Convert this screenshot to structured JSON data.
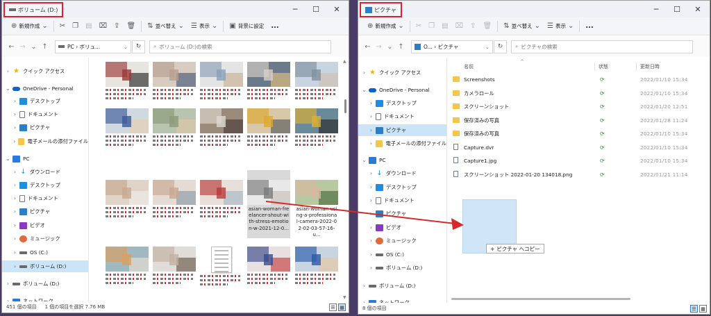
{
  "left": {
    "title": "ボリューム (D:)",
    "toolbar": {
      "new": "新規作成",
      "sort": "並べ替え",
      "view": "表示",
      "background": "背景に設定",
      "more": "..."
    },
    "address": "PC › ボリュ...",
    "search_placeholder": "ボリューム (D:)の検索",
    "nav": [
      {
        "label": "クイック アクセス",
        "icon": "star-icon"
      },
      {
        "label": "OneDrive - Personal",
        "icon": "cloud-icon"
      },
      {
        "label": "デスクトップ",
        "icon": "desktop-icon"
      },
      {
        "label": "ドキュメント",
        "icon": "document-icon"
      },
      {
        "label": "ピクチャ",
        "icon": "pictures-icon"
      },
      {
        "label": "電子メールの添付ファイル",
        "icon": "folder-icon"
      },
      {
        "label": "PC",
        "icon": "pc-icon"
      },
      {
        "label": "ダウンロード",
        "icon": "download-icon"
      },
      {
        "label": "デスクトップ",
        "icon": "desktop-icon"
      },
      {
        "label": "ドキュメント",
        "icon": "document-icon"
      },
      {
        "label": "ピクチャ",
        "icon": "pictures-icon"
      },
      {
        "label": "ビデオ",
        "icon": "video-icon"
      },
      {
        "label": "ミュージック",
        "icon": "music-icon"
      },
      {
        "label": "OS (C:)",
        "icon": "drive-icon"
      },
      {
        "label": "ボリューム (D:)",
        "icon": "drive-icon"
      },
      {
        "label": "ボリューム (D:)",
        "icon": "drive-icon"
      },
      {
        "label": "ネットワーク",
        "icon": "network-icon"
      }
    ],
    "captions": {
      "selected": "asian-woman-freelancer-shout-with-stress-emotion-w-2021-12-0...",
      "neighbor": "asian-woman-using-a-professional-camera-2022-02-02-03-57-16-u..."
    },
    "status": {
      "count": "451 個の項目",
      "selection": "1 個の項目を選択 7.76 MB"
    }
  },
  "right": {
    "title": "ピクチャ",
    "toolbar": {
      "new": "新規作成",
      "sort": "並べ替え",
      "view": "表示",
      "more": "..."
    },
    "address": "O... › ピクチャ",
    "search_placeholder": "ピクチャの検索",
    "columns": {
      "name": "名前",
      "status": "状態",
      "modified": "更新日時"
    },
    "nav": [
      {
        "label": "クイック アクセス",
        "icon": "star-icon"
      },
      {
        "label": "OneDrive - Personal",
        "icon": "cloud-icon"
      },
      {
        "label": "デスクトップ",
        "icon": "desktop-icon"
      },
      {
        "label": "ドキュメント",
        "icon": "document-icon"
      },
      {
        "label": "ピクチャ",
        "icon": "pictures-icon"
      },
      {
        "label": "電子メールの添付ファイル",
        "icon": "folder-icon"
      },
      {
        "label": "PC",
        "icon": "pc-icon"
      },
      {
        "label": "ダウンロード",
        "icon": "download-icon"
      },
      {
        "label": "デスクトップ",
        "icon": "desktop-icon"
      },
      {
        "label": "ドキュメント",
        "icon": "document-icon"
      },
      {
        "label": "ピクチャ",
        "icon": "pictures-icon"
      },
      {
        "label": "ビデオ",
        "icon": "video-icon"
      },
      {
        "label": "ミュージック",
        "icon": "music-icon"
      },
      {
        "label": "OS (C:)",
        "icon": "drive-icon"
      },
      {
        "label": "ボリューム (D:)",
        "icon": "drive-icon"
      },
      {
        "label": "ボリューム (D:)",
        "icon": "drive-icon"
      },
      {
        "label": "ネットワーク",
        "icon": "network-icon"
      }
    ],
    "files": [
      {
        "name": "Screenshots",
        "date": "2022/01/10 15:34",
        "folder": true
      },
      {
        "name": "カメラロール",
        "date": "2022/01/10 15:34",
        "folder": true
      },
      {
        "name": "スクリーンショット",
        "date": "2022/01/20 12:51",
        "folder": true
      },
      {
        "name": "保存済みの写真",
        "date": "2022/01/28 11:24",
        "folder": true
      },
      {
        "name": "保存済みの写真",
        "date": "2022/01/10 15:34",
        "folder": true
      },
      {
        "name": "Capture.dvr",
        "date": "2022/01/10 15:34",
        "folder": false
      },
      {
        "name": "Capture1.jpg",
        "date": "2022/01/10 15:34",
        "folder": false
      },
      {
        "name": "スクリーンショット 2022-01-20 134018.png",
        "date": "2022/01/21 11:14",
        "folder": false
      }
    ],
    "drag_tip": "ピクチャ へコピー",
    "status": {
      "count": "8 個の項目"
    }
  },
  "colors": {
    "highlight": "#e0202a",
    "selection": "#cce4f7",
    "desktop_bg": "#4a3a66"
  }
}
